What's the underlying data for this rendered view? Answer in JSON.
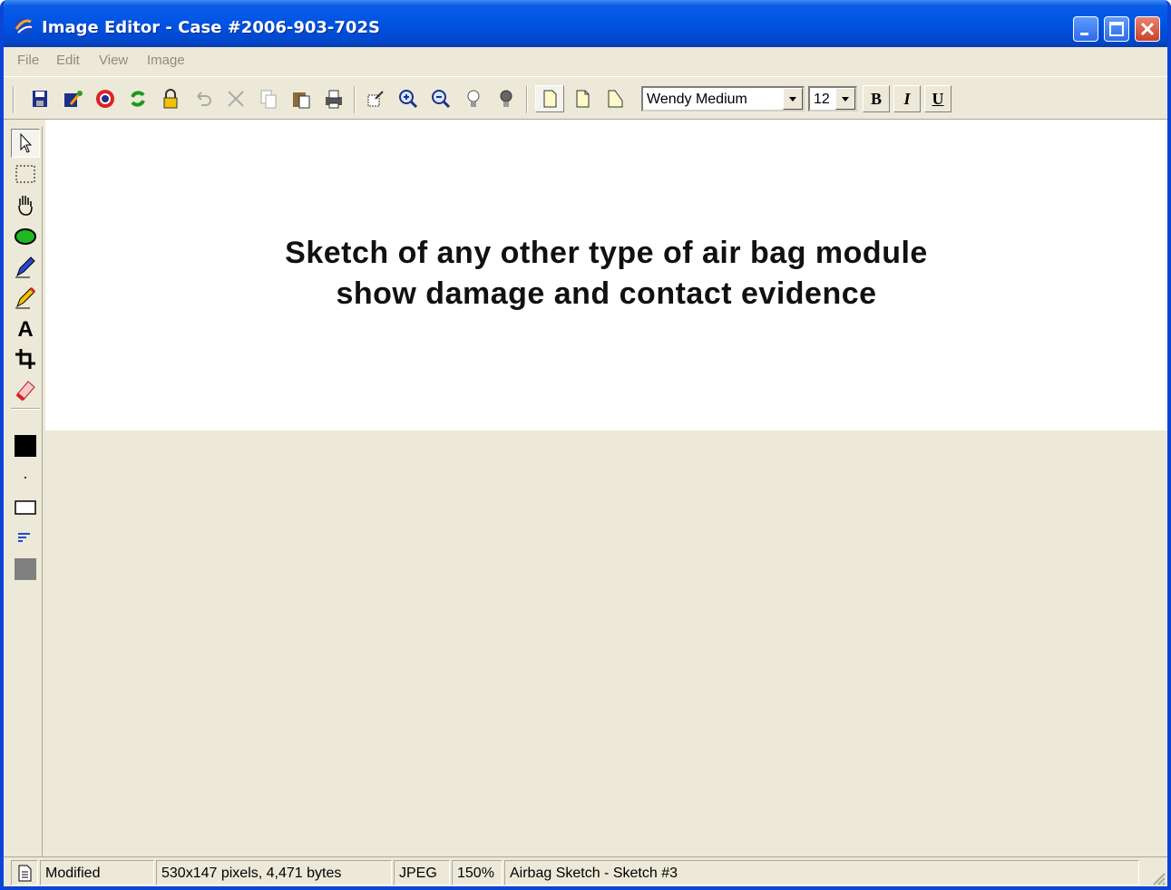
{
  "window": {
    "title": "Image Editor - Case #2006-903-702S"
  },
  "menu": [
    "File",
    "Edit",
    "View",
    "Image"
  ],
  "toolbar": {
    "icons": [
      "save-icon",
      "export-icon",
      "help-icon",
      "refresh-icon",
      "lock-icon",
      "undo-icon",
      "cut-icon",
      "copy-icon",
      "paste-icon",
      "print-icon",
      "zoom-fit-icon",
      "zoom-in-icon",
      "zoom-out-icon",
      "bulb-off-icon",
      "bulb-on-icon",
      "page-portrait-icon",
      "page-corner-icon",
      "page-landscape-icon"
    ],
    "font": "Wendy Medium",
    "font_size": "12",
    "bold": "B",
    "italic": "I",
    "underline": "U"
  },
  "tools": [
    "arrow-select-icon",
    "rect-select-icon",
    "hand-pan-icon",
    "ellipse-fill-icon",
    "pen-icon",
    "pencil-icon",
    "text-tool-icon",
    "crop-icon",
    "eraser-icon"
  ],
  "colors": {
    "fg": "#000000",
    "fill": "#808080",
    "brand": "#0054e3"
  },
  "canvas": {
    "line1": "Sketch of any other type of air bag module",
    "line2": "show damage and contact evidence"
  },
  "status": {
    "state": "Modified",
    "dimensions": "530x147 pixels, 4,471 bytes",
    "format": "JPEG",
    "zoom": "150%",
    "name": "Airbag Sketch - Sketch #3"
  }
}
